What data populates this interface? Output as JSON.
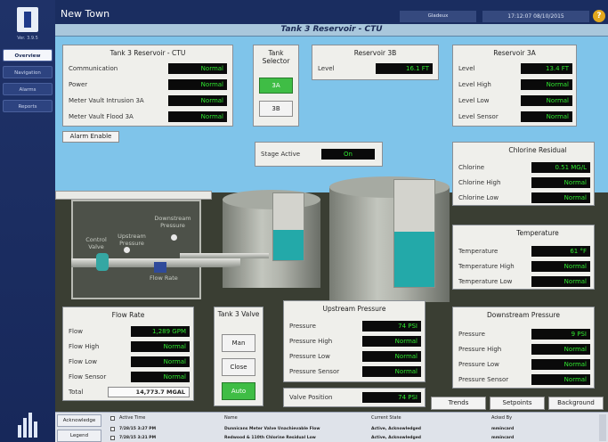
{
  "app": {
    "title": "New Town",
    "version": "Ver. 3.9.5",
    "user": "Gladeux",
    "clock": "17:12:07  08/10/2015",
    "help": "?"
  },
  "nav": [
    {
      "label": "Overview",
      "active": true
    },
    {
      "label": "Navigation",
      "active": false
    },
    {
      "label": "Alarms",
      "active": false
    },
    {
      "label": "Reports",
      "active": false
    }
  ],
  "page_title": "Tank 3 Reservoir - CTU",
  "ctu": {
    "title": "Tank 3 Reservoir - CTU",
    "rows": [
      {
        "label": "Communication",
        "value": "Normal"
      },
      {
        "label": "Power",
        "value": "Normal"
      },
      {
        "label": "Meter Vault Intrusion 3A",
        "value": "Normal"
      },
      {
        "label": "Meter Vault Flood 3A",
        "value": "Normal"
      }
    ]
  },
  "selector": {
    "title": "Tank Selector",
    "btn_3a": "3A",
    "btn_3b": "3B"
  },
  "res3b": {
    "title": "Reservoir 3B",
    "label": "Level",
    "value": "16.1 FT"
  },
  "res3a": {
    "title": "Reservoir 3A",
    "rows": [
      {
        "label": "Level",
        "value": "13.4 FT"
      },
      {
        "label": "Level High",
        "value": "Normal"
      },
      {
        "label": "Level Low",
        "value": "Normal"
      },
      {
        "label": "Level Sensor",
        "value": "Normal"
      }
    ]
  },
  "alarm_enable": "Alarm Enable",
  "stage": {
    "label": "Stage Active",
    "value": "On"
  },
  "chlorine": {
    "title": "Chlorine Residual",
    "rows": [
      {
        "label": "Chlorine",
        "value": "0.51 MG/L"
      },
      {
        "label": "Chlorine High",
        "value": "Normal"
      },
      {
        "label": "Chlorine Low",
        "value": "Normal"
      }
    ]
  },
  "diagram": {
    "downstream": "Downstream Pressure",
    "control_valve": "Control Valve",
    "upstream": "Upstream Pressure",
    "flow_rate": "Flow Rate",
    "tank3a_level_fraction": 0.45,
    "tank3b_level_fraction": 0.52
  },
  "temperature": {
    "title": "Temperature",
    "rows": [
      {
        "label": "Temperature",
        "value": "61 °F"
      },
      {
        "label": "Temperature High",
        "value": "Normal"
      },
      {
        "label": "Temperature Low",
        "value": "Normal"
      }
    ]
  },
  "flow": {
    "title": "Flow Rate",
    "rows": [
      {
        "label": "Flow",
        "value": "1,289 GPM"
      },
      {
        "label": "Flow High",
        "value": "Normal"
      },
      {
        "label": "Flow Low",
        "value": "Normal"
      },
      {
        "label": "Flow Sensor",
        "value": "Normal"
      }
    ],
    "total_label": "Total",
    "total_value": "14,773.7 MGAL"
  },
  "valve": {
    "title": "Tank 3 Valve",
    "man": "Man",
    "close": "Close",
    "auto": "Auto"
  },
  "upstream": {
    "title": "Upstream Pressure",
    "rows": [
      {
        "label": "Pressure",
        "value": "74 PSI"
      },
      {
        "label": "Pressure High",
        "value": "Normal"
      },
      {
        "label": "Pressure Low",
        "value": "Normal"
      },
      {
        "label": "Pressure Sensor",
        "value": "Normal"
      }
    ],
    "valve_pos_label": "Valve Position",
    "valve_pos_value": "74 PSI"
  },
  "downstream": {
    "title": "Downstream Pressure",
    "rows": [
      {
        "label": "Pressure",
        "value": "9 PSI"
      },
      {
        "label": "Pressure High",
        "value": "Normal"
      },
      {
        "label": "Pressure Low",
        "value": "Normal"
      },
      {
        "label": "Pressure Sensor",
        "value": "Normal"
      }
    ]
  },
  "tabs": {
    "trends": "Trends",
    "setpoints": "Setpoints",
    "background": "Background"
  },
  "alarms": {
    "acknowledge": "Acknowledge",
    "legend": "Legend",
    "headers": {
      "time": "Active Time",
      "name": "Name",
      "state": "Current State",
      "by": "Acked By"
    },
    "rows": [
      {
        "time": "7/28/15 3:27 PM",
        "name": "Dunnicans Meter Valve Unachievable Flow",
        "state": "Active, Acknowledged",
        "by": "mmincard"
      },
      {
        "time": "7/28/15 3:21 PM",
        "name": "Redwood & 110th Chlorine Residual Low",
        "state": "Active, Acknowledged",
        "by": "mmincard"
      }
    ]
  },
  "colors": {
    "accent_green": "#2fe62f",
    "sky": "#7fc4ea",
    "water": "#23a9a9",
    "nav": "#1d2f63"
  }
}
